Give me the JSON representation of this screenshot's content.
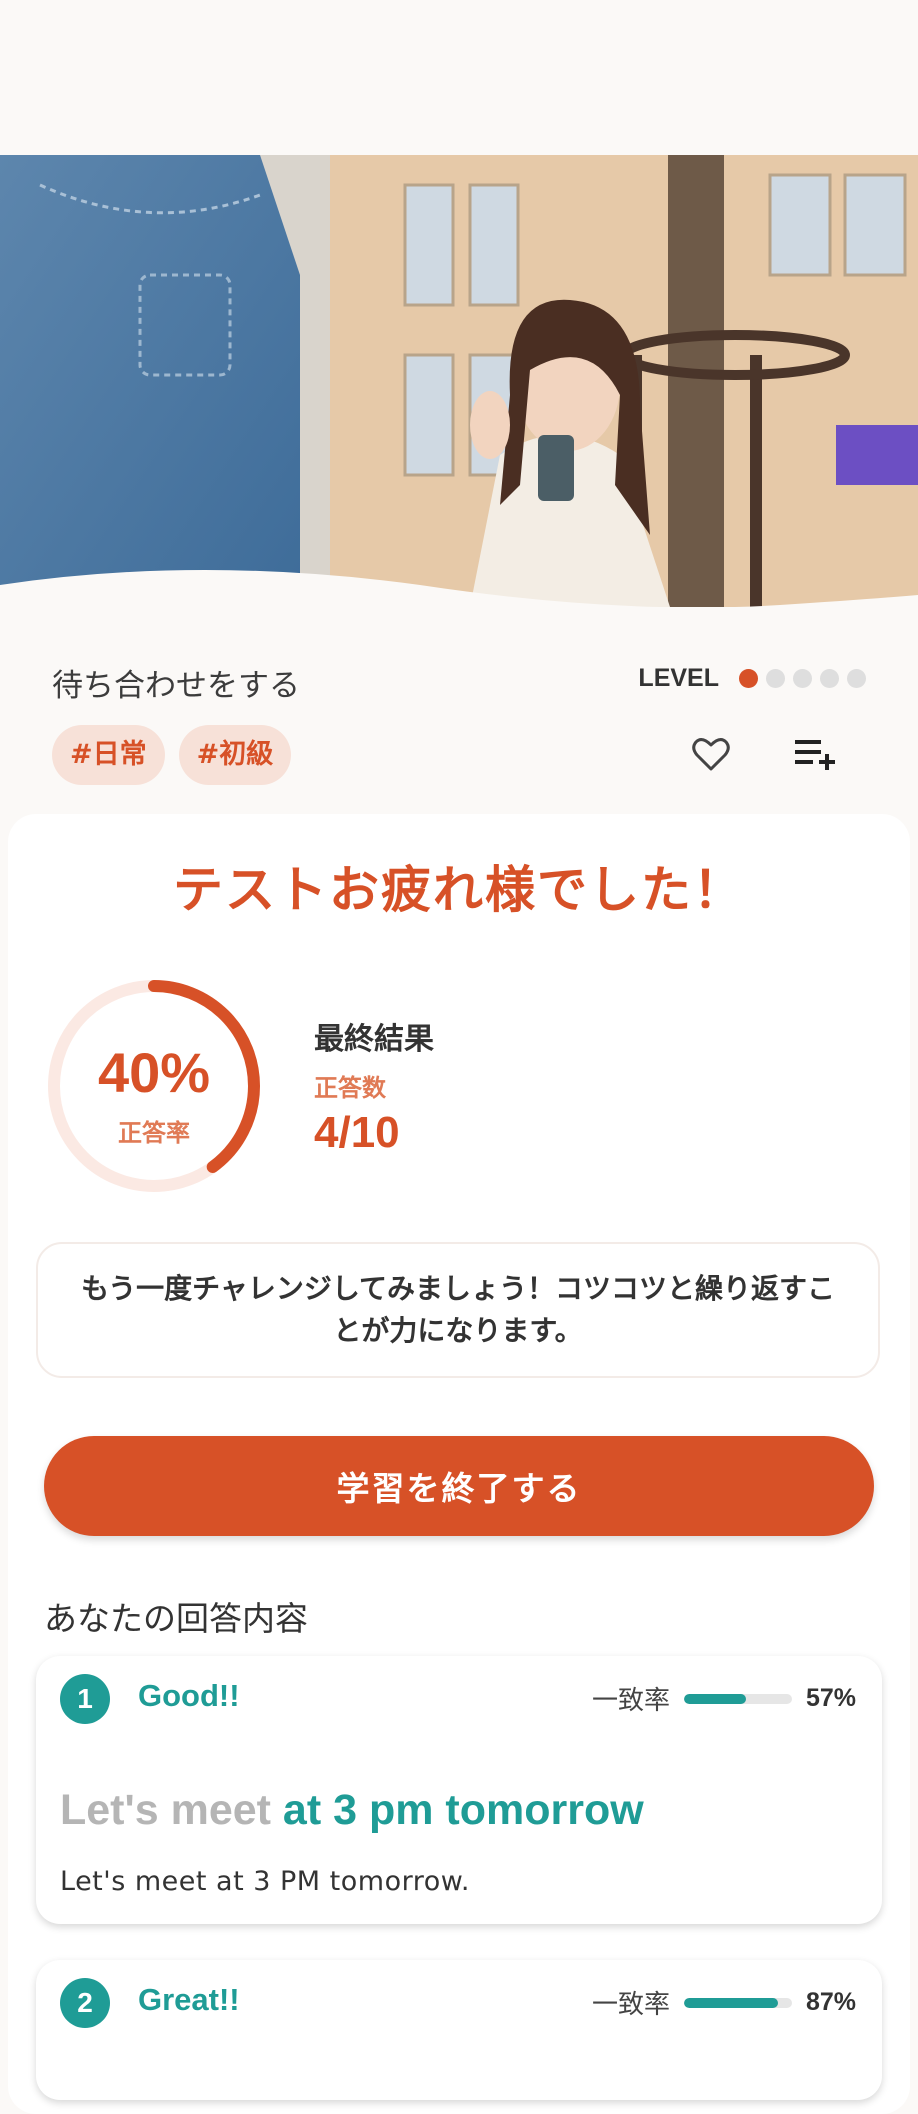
{
  "lesson": {
    "title": "待ち合わせをする",
    "level_label": "LEVEL",
    "level": 1,
    "level_max": 5,
    "tags": [
      "#日常",
      "#初級"
    ]
  },
  "icons": {
    "favorite": "heart-outline-icon",
    "add_to_list": "playlist-add-icon"
  },
  "result": {
    "title": "テストお疲れ様でした！",
    "percent_text": "40%",
    "percent_label": "正答率",
    "percent_value": 0.4,
    "final_title": "最終結果",
    "correct_label": "正答数",
    "score": "4/10",
    "message": "もう一度チャレンジしてみましょう！コツコツと繰り返すことが力になります。"
  },
  "finish_button": "学習を終了する",
  "answers_title": "あなたの回答内容",
  "answers": [
    {
      "number": "1",
      "verdict": "Good!!",
      "match_label": "一致率",
      "match_percent": "57%",
      "match_value": 0.57,
      "sentence_gray": "Let's meet ",
      "sentence_teal": "at 3 pm tomorrow",
      "correct_sentence": "Let's meet at 3 PM tomorrow."
    },
    {
      "number": "2",
      "verdict": "Great!!",
      "match_label": "一致率",
      "match_percent": "87%",
      "match_value": 0.87
    }
  ],
  "colors": {
    "accent": "#d75127",
    "teal": "#1f9c96",
    "tag_bg": "#f7e1d8"
  }
}
